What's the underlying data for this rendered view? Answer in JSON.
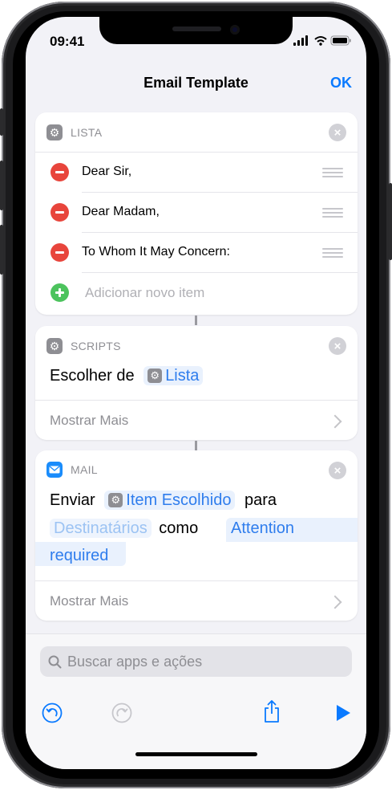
{
  "status_bar": {
    "time": "09:41"
  },
  "nav": {
    "title": "Email Template",
    "ok_label": "OK"
  },
  "list_action": {
    "header": "LISTA",
    "items": [
      "Dear Sir,",
      "Dear Madam,",
      "To Whom It May Concern:"
    ],
    "add_item_placeholder": "Adicionar novo item"
  },
  "scripts_action": {
    "header": "SCRIPTS",
    "verb": "Escolher de",
    "token": "Lista",
    "show_more": "Mostrar Mais"
  },
  "mail_action": {
    "header": "MAIL",
    "verb": "Enviar",
    "item_token": "Item Escolhido",
    "to_word": "para",
    "recipients_placeholder": "Destinatários",
    "as_word": "como",
    "subject_token_line1": "Attention",
    "subject_token_line2": "required",
    "show_more": "Mostrar Mais"
  },
  "search": {
    "placeholder": "Buscar apps e ações"
  },
  "colors": {
    "accent": "#0a7aff",
    "delete": "#e8453c",
    "add": "#4cc35d",
    "token_bg": "#e9f1fd"
  },
  "icons": [
    "gear-icon",
    "mail-icon",
    "close-icon",
    "minus-icon",
    "plus-icon",
    "drag-handle-icon",
    "chevron-right-icon",
    "search-icon",
    "undo-icon",
    "redo-icon",
    "share-icon",
    "play-icon"
  ]
}
